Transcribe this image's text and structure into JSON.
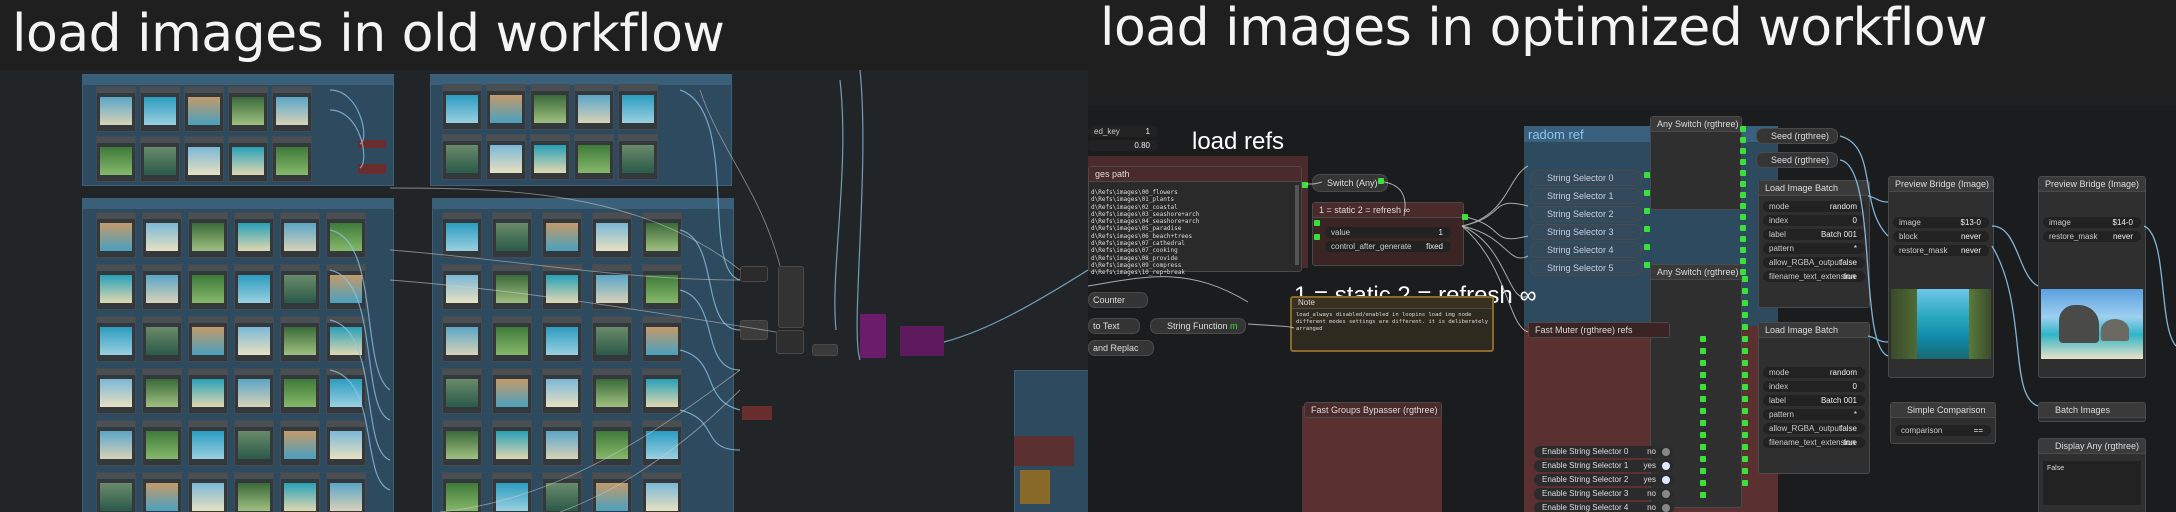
{
  "titles": {
    "left": "load images in old workflow",
    "right": "load images in optimized workflow"
  },
  "colors": {
    "background": "#1f1f1f",
    "group_blue": "#2e4a5e",
    "group_red": "#5a3030",
    "accent_green": "#3ce03c",
    "link_blue": "#8ec5e8"
  },
  "right": {
    "top_fragment": {
      "key_label": "ed_key",
      "key_value": "1",
      "value_2": "0.80"
    },
    "load_refs_label": "load refs",
    "images_path_node": {
      "title": "ges path",
      "lines": [
        "d\\Refs\\images\\00_flowers",
        "d\\Refs\\images\\01_plants",
        "d\\Refs\\images\\02_coastal",
        "d\\Refs\\images\\03_seashore+arch",
        "d\\Refs\\images\\04_seashore+arch",
        "d\\Refs\\images\\05_paradise",
        "d\\Refs\\images\\06_beach+trees",
        "d\\Refs\\images\\07_cathedral",
        "d\\Refs\\images\\07_cooking",
        "d\\Refs\\images\\08_provide",
        "d\\Refs\\images\\09_compress",
        "d\\Refs\\images\\10_rep+break"
      ]
    },
    "switch_any": "Switch (Any)",
    "static_node": {
      "title": "1 = static 2 = refresh ∞",
      "value_label": "value",
      "value": "1",
      "control_label": "control_after_generate",
      "control_value": "fixed"
    },
    "static_overlay": "1 = static 2 = refresh ∞",
    "note": {
      "title": "Note",
      "text": "load_always disabled/enabled in loopins load img node\ndifferent modes settings are different. it is deliberately\narranged"
    },
    "counter": "Counter",
    "to_text": "to Text",
    "string_function": "String Function",
    "string_function_value": "m",
    "and_replace": "and Replac",
    "random_ref": {
      "title": "radom ref",
      "items": [
        "String Selector 0",
        "String Selector 1",
        "String Selector 2",
        "String Selector 3",
        "String Selector 4",
        "String Selector 5"
      ]
    },
    "any_switch_1": "Any Switch (rgthree)",
    "any_switch_2": "Any Switch (rgthree)",
    "seed_1": "Seed (rgthree)",
    "seed_2": "Seed (rgthree)",
    "load_image_batch_1": {
      "title": "Load Image Batch",
      "mode_label": "mode",
      "mode": "random",
      "index_label": "index",
      "index": "0",
      "label_label": "label",
      "label": "Batch 001",
      "pattern_label": "pattern",
      "pattern": "*",
      "rgba_label": "allow_RGBA_output",
      "rgba": "false",
      "ext_label": "filename_text_extension",
      "ext": "true"
    },
    "load_image_batch_2": {
      "title": "Load Image Batch",
      "mode_label": "mode",
      "mode": "random",
      "index_label": "index",
      "index": "0",
      "label_label": "label",
      "label": "Batch 001",
      "pattern_label": "pattern",
      "pattern": "*",
      "rgba_label": "allow_RGBA_output",
      "rgba": "false",
      "ext_label": "filename_text_extension",
      "ext": "true"
    },
    "preview_1": {
      "title": "Preview Bridge (Image)",
      "image_label": "image",
      "image": "$13-0",
      "block_label": "block",
      "block": "never",
      "restore_label": "restore_mask",
      "restore": "never"
    },
    "preview_2": {
      "title": "Preview Bridge (Image)",
      "image_label": "image",
      "image": "$14-0",
      "restore_label": "restore_mask",
      "restore": "never"
    },
    "fast_muter": "Fast Muter (rgthree) refs",
    "fast_groups": "Fast Groups Bypasser (rgthree)",
    "enable_rows": [
      {
        "label": "Enable String Selector 0",
        "value": "no",
        "on": false
      },
      {
        "label": "Enable String Selector 1",
        "value": "yes",
        "on": true
      },
      {
        "label": "Enable String Selector 2",
        "value": "yes",
        "on": true
      },
      {
        "label": "Enable String Selector 3",
        "value": "no",
        "on": false
      },
      {
        "label": "Enable String Selector 4",
        "value": "no",
        "on": false
      }
    ],
    "simple_comparison": {
      "title": "Simple Comparison",
      "comparison_label": "comparison",
      "comparison": "=="
    },
    "batch_images": "Batch Images",
    "display_any": "Display Any (rgthree)",
    "display_value": "False"
  }
}
